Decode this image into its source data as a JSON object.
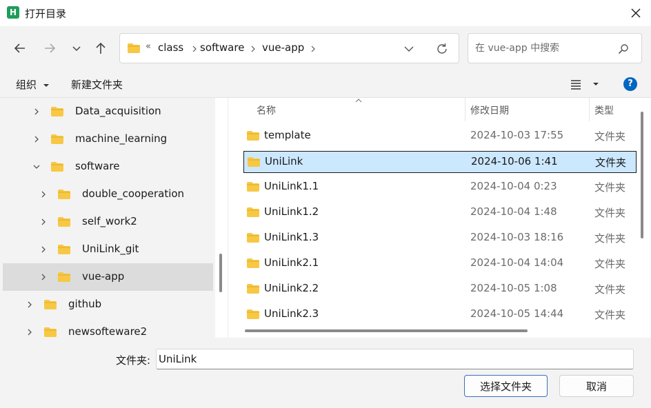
{
  "window": {
    "title": "打开目录",
    "app_icon_letter": "H"
  },
  "nav": {
    "breadcrumb": [
      "«",
      "class",
      "software",
      "vue-app"
    ],
    "search_placeholder": "在 vue-app 中搜索"
  },
  "toolbar": {
    "organize": "组织",
    "new_folder": "新建文件夹",
    "help": "?"
  },
  "tree": [
    {
      "label": "Data_acquisition",
      "level": 1,
      "expanded": false,
      "selected": false
    },
    {
      "label": "machine_learning",
      "level": 1,
      "expanded": false,
      "selected": false
    },
    {
      "label": "software",
      "level": 1,
      "expanded": true,
      "selected": false
    },
    {
      "label": "double_cooperation",
      "level": 2,
      "expanded": false,
      "selected": false
    },
    {
      "label": "self_work2",
      "level": 2,
      "expanded": false,
      "selected": false
    },
    {
      "label": "UniLink_git",
      "level": 2,
      "expanded": false,
      "selected": false
    },
    {
      "label": "vue-app",
      "level": 2,
      "expanded": false,
      "selected": true
    },
    {
      "label": "github",
      "level": 0,
      "expanded": false,
      "selected": false
    },
    {
      "label": "newsofteware2",
      "level": 0,
      "expanded": false,
      "selected": false
    }
  ],
  "columns": {
    "name": "名称",
    "date": "修改日期",
    "type": "类型"
  },
  "files": [
    {
      "name": "template",
      "date": "2024-10-03 17:55",
      "type": "文件夹",
      "selected": false
    },
    {
      "name": "UniLink",
      "date": "2024-10-06 1:41",
      "type": "文件夹",
      "selected": true
    },
    {
      "name": "UniLink1.1",
      "date": "2024-10-04 0:23",
      "type": "文件夹",
      "selected": false
    },
    {
      "name": "UniLink1.2",
      "date": "2024-10-04 1:48",
      "type": "文件夹",
      "selected": false
    },
    {
      "name": "UniLink1.3",
      "date": "2024-10-03 18:16",
      "type": "文件夹",
      "selected": false
    },
    {
      "name": "UniLink2.1",
      "date": "2024-10-04 14:04",
      "type": "文件夹",
      "selected": false
    },
    {
      "name": "UniLink2.2",
      "date": "2024-10-05 1:08",
      "type": "文件夹",
      "selected": false
    },
    {
      "name": "UniLink2.3",
      "date": "2024-10-05 14:44",
      "type": "文件夹",
      "selected": false
    }
  ],
  "footer": {
    "folder_label": "文件夹:",
    "folder_value": "UniLink",
    "select_button": "选择文件夹",
    "cancel_button": "取消"
  },
  "colors": {
    "accent": "#0067c0",
    "folder": "#f7c844",
    "selection": "#cce8ff",
    "app_icon": "#1e9e5a"
  }
}
